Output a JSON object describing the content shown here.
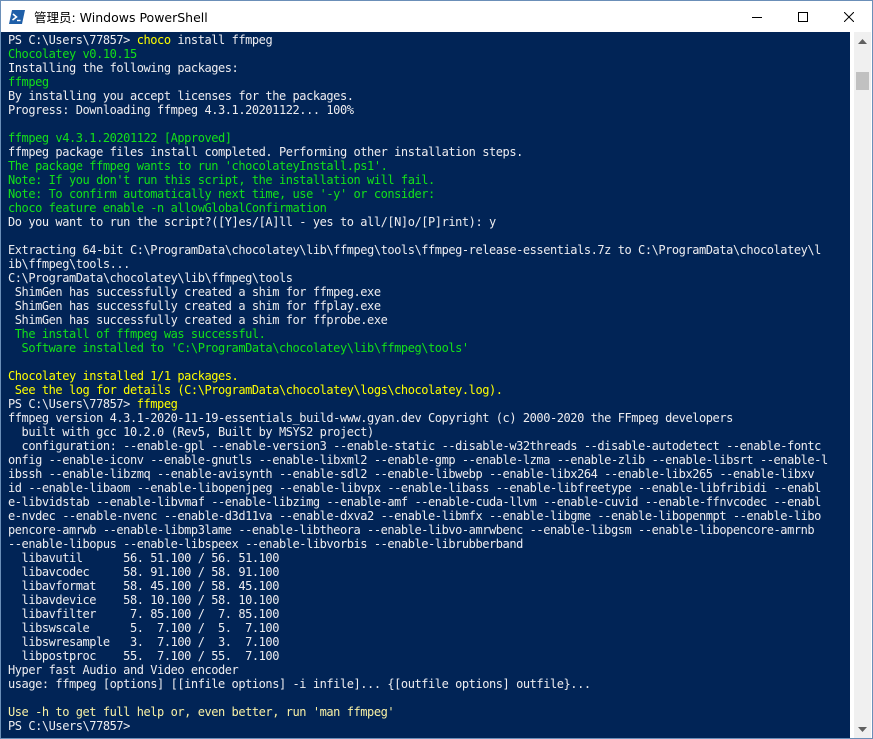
{
  "window": {
    "title": "管理员: Windows PowerShell",
    "icons": {
      "app": "powershell-icon",
      "minimize": "minimize-icon",
      "maximize": "maximize-icon",
      "close": "close-icon"
    }
  },
  "colors": {
    "console_bg": "#012456",
    "text_default": "#eeedf0",
    "text_green": "#13e019",
    "text_yellow": "#ffff00",
    "text_pale_yellow": "#f9f1a5"
  },
  "console": {
    "lines": [
      {
        "segments": [
          {
            "text": "PS C:\\Users\\77857> ",
            "color": "default"
          },
          {
            "text": "choco",
            "color": "yellow"
          },
          {
            "text": " install ffmpeg",
            "color": "default"
          }
        ]
      },
      {
        "segments": [
          {
            "text": "Chocolatey v0.10.15",
            "color": "green"
          }
        ]
      },
      {
        "segments": [
          {
            "text": "Installing the following packages:",
            "color": "default"
          }
        ]
      },
      {
        "segments": [
          {
            "text": "ffmpeg",
            "color": "green"
          }
        ]
      },
      {
        "segments": [
          {
            "text": "By installing you accept licenses for the packages.",
            "color": "default"
          }
        ]
      },
      {
        "segments": [
          {
            "text": "Progress: Downloading ffmpeg 4.3.1.20201122... 100%",
            "color": "default"
          }
        ]
      },
      {
        "segments": [
          {
            "text": "",
            "color": "default"
          }
        ]
      },
      {
        "segments": [
          {
            "text": "ffmpeg v4.3.1.20201122 [Approved]",
            "color": "green"
          }
        ]
      },
      {
        "segments": [
          {
            "text": "ffmpeg package files install completed. Performing other installation steps.",
            "color": "default"
          }
        ]
      },
      {
        "segments": [
          {
            "text": "The package ffmpeg wants to run 'chocolateyInstall.ps1'.",
            "color": "green"
          }
        ]
      },
      {
        "segments": [
          {
            "text": "Note: If you don't run this script, the installation will fail.",
            "color": "green"
          }
        ]
      },
      {
        "segments": [
          {
            "text": "Note: To confirm automatically next time, use '-y' or consider:",
            "color": "green"
          }
        ]
      },
      {
        "segments": [
          {
            "text": "choco feature enable -n allowGlobalConfirmation",
            "color": "green"
          }
        ]
      },
      {
        "segments": [
          {
            "text": "Do you want to run the script?([Y]es/[A]ll - yes to all/[N]o/[P]rint): y",
            "color": "default"
          }
        ]
      },
      {
        "segments": [
          {
            "text": "",
            "color": "default"
          }
        ]
      },
      {
        "segments": [
          {
            "text": "Extracting 64-bit C:\\ProgramData\\chocolatey\\lib\\ffmpeg\\tools\\ffmpeg-release-essentials.7z to C:\\ProgramData\\chocolatey\\l",
            "color": "default"
          }
        ]
      },
      {
        "segments": [
          {
            "text": "ib\\ffmpeg\\tools...",
            "color": "default"
          }
        ]
      },
      {
        "segments": [
          {
            "text": "C:\\ProgramData\\chocolatey\\lib\\ffmpeg\\tools",
            "color": "default"
          }
        ]
      },
      {
        "segments": [
          {
            "text": " ShimGen has successfully created a shim for ffmpeg.exe",
            "color": "default"
          }
        ]
      },
      {
        "segments": [
          {
            "text": " ShimGen has successfully created a shim for ffplay.exe",
            "color": "default"
          }
        ]
      },
      {
        "segments": [
          {
            "text": " ShimGen has successfully created a shim for ffprobe.exe",
            "color": "default"
          }
        ]
      },
      {
        "segments": [
          {
            "text": " The install of ffmpeg was successful.",
            "color": "green"
          }
        ]
      },
      {
        "segments": [
          {
            "text": "  Software installed to 'C:\\ProgramData\\chocolatey\\lib\\ffmpeg\\tools'",
            "color": "green"
          }
        ]
      },
      {
        "segments": [
          {
            "text": "",
            "color": "default"
          }
        ]
      },
      {
        "segments": [
          {
            "text": "Chocolatey installed 1/1 packages.",
            "color": "yellow"
          }
        ]
      },
      {
        "segments": [
          {
            "text": " See the log for details (C:\\ProgramData\\chocolatey\\logs\\chocolatey.log).",
            "color": "yellow"
          }
        ]
      },
      {
        "segments": [
          {
            "text": "PS C:\\Users\\77857> ",
            "color": "default"
          },
          {
            "text": "ffmpeg",
            "color": "yellow"
          }
        ]
      },
      {
        "segments": [
          {
            "text": "ffmpeg version 4.3.1-2020-11-19-essentials_build-www.gyan.dev Copyright (c) 2000-2020 the FFmpeg developers",
            "color": "default"
          }
        ]
      },
      {
        "segments": [
          {
            "text": "  built with gcc 10.2.0 (Rev5, Built by MSYS2 project)",
            "color": "default"
          }
        ]
      },
      {
        "segments": [
          {
            "text": "  configuration: --enable-gpl --enable-version3 --enable-static --disable-w32threads --disable-autodetect --enable-fontc",
            "color": "default"
          }
        ]
      },
      {
        "segments": [
          {
            "text": "onfig --enable-iconv --enable-gnutls --enable-libxml2 --enable-gmp --enable-lzma --enable-zlib --enable-libsrt --enable-l",
            "color": "default"
          }
        ]
      },
      {
        "segments": [
          {
            "text": "ibssh --enable-libzmq --enable-avisynth --enable-sdl2 --enable-libwebp --enable-libx264 --enable-libx265 --enable-libxv",
            "color": "default"
          }
        ]
      },
      {
        "segments": [
          {
            "text": "id --enable-libaom --enable-libopenjpeg --enable-libvpx --enable-libass --enable-libfreetype --enable-libfribidi --enabl",
            "color": "default"
          }
        ]
      },
      {
        "segments": [
          {
            "text": "e-libvidstab --enable-libvmaf --enable-libzimg --enable-amf --enable-cuda-llvm --enable-cuvid --enable-ffnvcodec --enabl",
            "color": "default"
          }
        ]
      },
      {
        "segments": [
          {
            "text": "e-nvdec --enable-nvenc --enable-d3d11va --enable-dxva2 --enable-libmfx --enable-libgme --enable-libopenmpt --enable-libo",
            "color": "default"
          }
        ]
      },
      {
        "segments": [
          {
            "text": "pencore-amrwb --enable-libmp3lame --enable-libtheora --enable-libvo-amrwbenc --enable-libgsm --enable-libopencore-amrnb",
            "color": "default"
          }
        ]
      },
      {
        "segments": [
          {
            "text": "--enable-libopus --enable-libspeex --enable-libvorbis --enable-librubberband",
            "color": "default"
          }
        ]
      },
      {
        "segments": [
          {
            "text": "  libavutil      56. 51.100 / 56. 51.100",
            "color": "default"
          }
        ]
      },
      {
        "segments": [
          {
            "text": "  libavcodec     58. 91.100 / 58. 91.100",
            "color": "default"
          }
        ]
      },
      {
        "segments": [
          {
            "text": "  libavformat    58. 45.100 / 58. 45.100",
            "color": "default"
          }
        ]
      },
      {
        "segments": [
          {
            "text": "  libavdevice    58. 10.100 / 58. 10.100",
            "color": "default"
          }
        ]
      },
      {
        "segments": [
          {
            "text": "  libavfilter     7. 85.100 /  7. 85.100",
            "color": "default"
          }
        ]
      },
      {
        "segments": [
          {
            "text": "  libswscale      5.  7.100 /  5.  7.100",
            "color": "default"
          }
        ]
      },
      {
        "segments": [
          {
            "text": "  libswresample   3.  7.100 /  3.  7.100",
            "color": "default"
          }
        ]
      },
      {
        "segments": [
          {
            "text": "  libpostproc    55.  7.100 / 55.  7.100",
            "color": "default"
          }
        ]
      },
      {
        "segments": [
          {
            "text": "Hyper fast Audio and Video encoder",
            "color": "default"
          }
        ]
      },
      {
        "segments": [
          {
            "text": "usage: ffmpeg [options] [[infile options] -i infile]... {[outfile options] outfile}...",
            "color": "default"
          }
        ]
      },
      {
        "segments": [
          {
            "text": "",
            "color": "default"
          }
        ]
      },
      {
        "segments": [
          {
            "text": "Use -h to get full help or, even better, run 'man ffmpeg'",
            "color": "pale_yellow"
          }
        ]
      },
      {
        "segments": [
          {
            "text": "PS C:\\Users\\77857> ",
            "color": "default"
          }
        ]
      }
    ]
  }
}
